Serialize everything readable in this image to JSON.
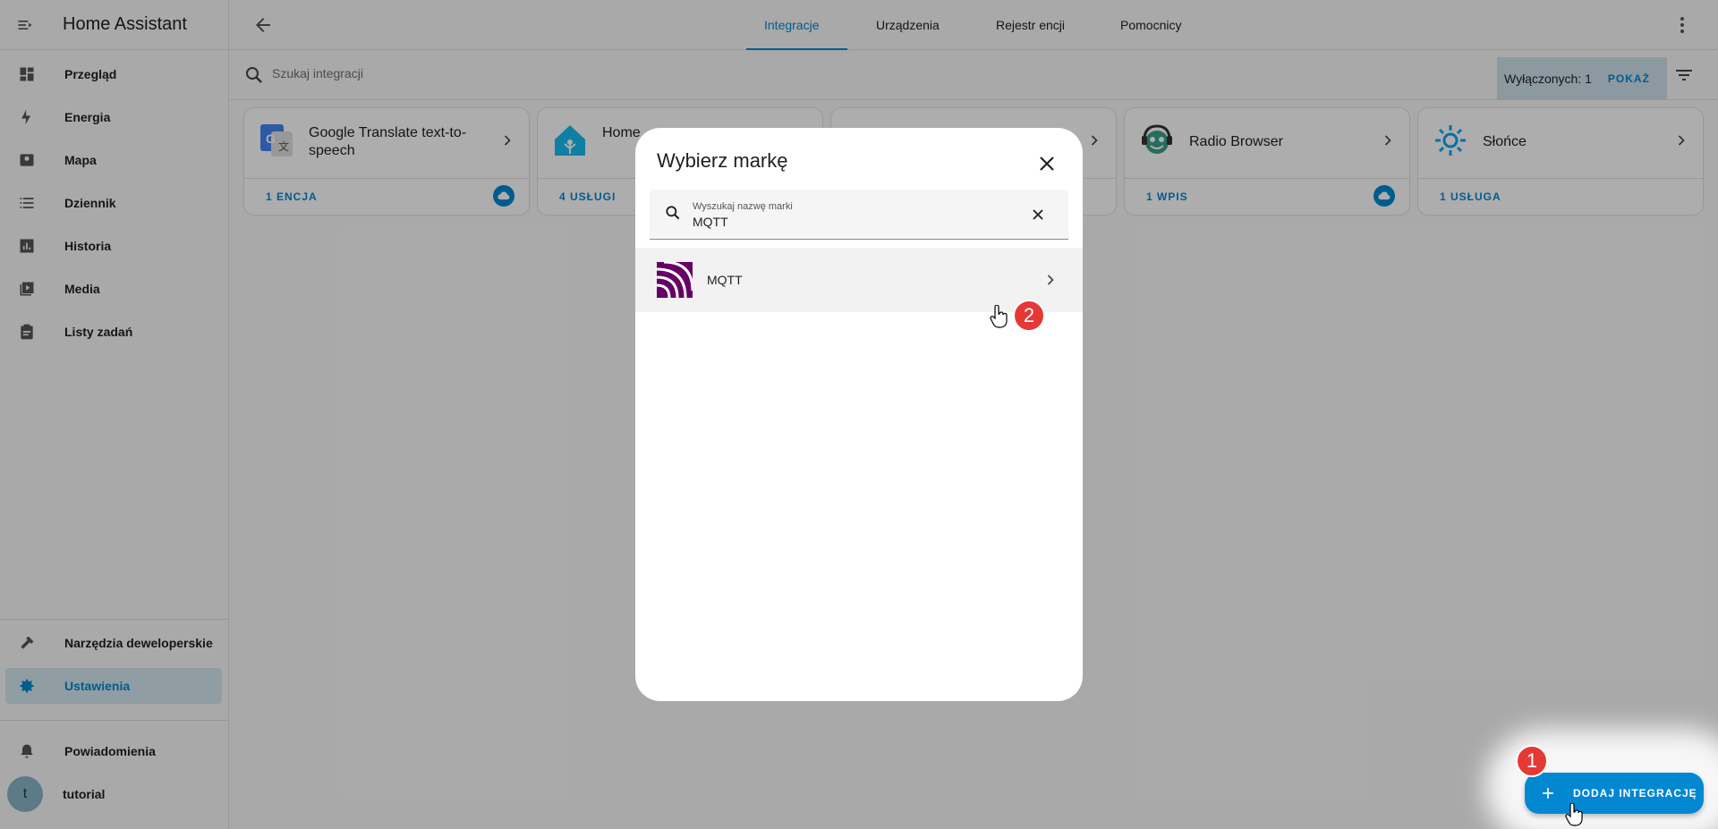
{
  "app": {
    "title": "Home Assistant"
  },
  "sidebar": {
    "items": [
      {
        "label": "Przegląd",
        "icon": "dashboard-icon"
      },
      {
        "label": "Energia",
        "icon": "lightning-icon"
      },
      {
        "label": "Mapa",
        "icon": "map-icon"
      },
      {
        "label": "Dziennik",
        "icon": "list-icon"
      },
      {
        "label": "Historia",
        "icon": "chart-icon"
      },
      {
        "label": "Media",
        "icon": "media-icon"
      },
      {
        "label": "Listy zadań",
        "icon": "clipboard-icon"
      }
    ],
    "bottom": [
      {
        "label": "Narzędzia deweloperskie",
        "icon": "hammer-icon"
      },
      {
        "label": "Ustawienia",
        "icon": "gear-icon",
        "active": true
      }
    ],
    "notifications": "Powiadomienia",
    "user": {
      "name": "tutorial",
      "initial": "t"
    }
  },
  "tabs": [
    {
      "label": "Integracje",
      "active": true
    },
    {
      "label": "Urządzenia"
    },
    {
      "label": "Rejestr encji"
    },
    {
      "label": "Pomocnicy"
    }
  ],
  "search": {
    "placeholder": "Szukaj integracji"
  },
  "disabled": {
    "text": "Wyłączonych: 1",
    "action": "POKAŻ"
  },
  "cards": [
    {
      "name": "Google Translate text-to-speech",
      "count": "1 ENCJA",
      "cloud": true
    },
    {
      "name": "Home",
      "count": "4 USŁUGI"
    },
    {
      "name": "",
      "count": ""
    },
    {
      "name": "Radio Browser",
      "count": "1 WPIS",
      "cloud": true
    },
    {
      "name": "Słońce",
      "count": "1 USŁUGA"
    }
  ],
  "dialog": {
    "title": "Wybierz markę",
    "search_label": "Wyszukaj nazwę marki",
    "search_value": "MQTT",
    "results": [
      {
        "name": "MQTT"
      }
    ]
  },
  "fab": {
    "label": "DODAJ INTEGRACJĘ"
  },
  "badges": {
    "one": "1",
    "two": "2"
  },
  "colors": {
    "accent": "#0288d1",
    "badge": "#e53935",
    "mqtt": "#660066"
  }
}
